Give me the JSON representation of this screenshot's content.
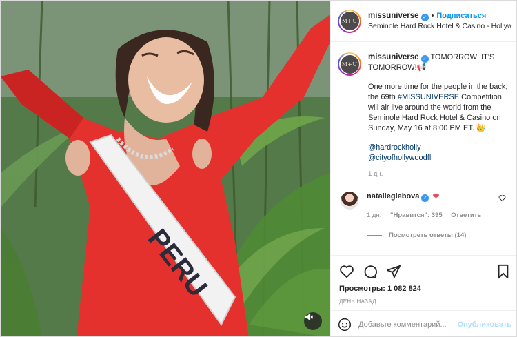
{
  "header": {
    "avatar_text": "M+U",
    "username": "missuniverse",
    "follow_label": "Подписаться",
    "location": "Seminole Hard Rock Hotel & Casino - Hollywood"
  },
  "media": {
    "sash_text": "PERU",
    "mute_icon": "speaker-muted-icon"
  },
  "caption": {
    "username": "missuniverse",
    "headline": "TOMORROW! IT'S TOMORROW!📢",
    "body_before_tag": "One more time for the people in the back, the 69th ",
    "hashtag": "#MISSUNIVERSE",
    "body_after_tag": " Competition will air live around the world from the Seminole Hard Rock Hotel & Casino on Sunday, May 16 at 8:00 PM ET. 👑",
    "mention_1": "@hardrockholly",
    "mention_2": "@cityofhollywoodfl",
    "time": "1 дн."
  },
  "reply": {
    "username": "natalieglebova",
    "heart": "❤",
    "time": "1 дн.",
    "likes": "\"Нравится\": 395",
    "reply_label": "Ответить",
    "view_replies": "Посмотреть ответы (14)"
  },
  "actions": {
    "views_label": "Просмотры:",
    "views_count": "1 082 824",
    "date": "ДЕНЬ НАЗАД"
  },
  "comment_box": {
    "placeholder": "Добавьте комментарий...",
    "publish_label": "Опубликовать"
  },
  "colors": {
    "accent": "#0095f6",
    "verified": "#3897f0",
    "like_red": "#ed4956",
    "dress_red": "#e5312e"
  }
}
